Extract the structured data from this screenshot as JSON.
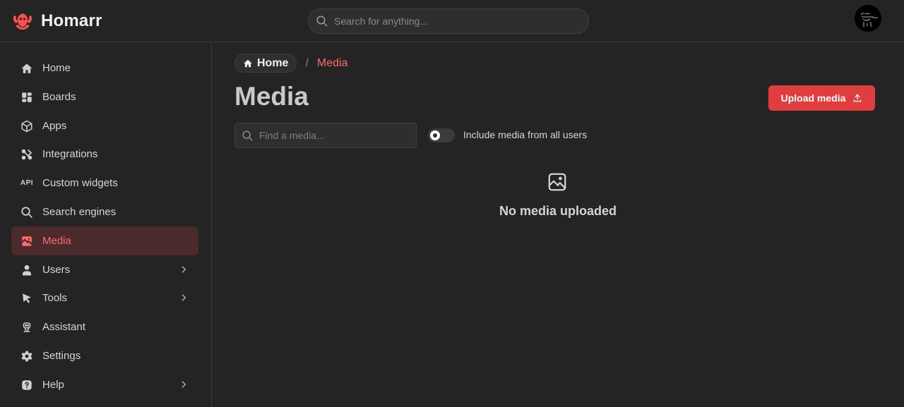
{
  "app": {
    "title": "Homarr",
    "brand_color": "#fa5252"
  },
  "header": {
    "search_placeholder": "Search for anything...",
    "avatar_icon": "user-avatar"
  },
  "sidebar": {
    "items": [
      {
        "label": "Home",
        "icon": "home-icon",
        "active": false,
        "has_children": false
      },
      {
        "label": "Boards",
        "icon": "layout-icon",
        "active": false,
        "has_children": false
      },
      {
        "label": "Apps",
        "icon": "box-icon",
        "active": false,
        "has_children": false
      },
      {
        "label": "Integrations",
        "icon": "plug-icon",
        "active": false,
        "has_children": false
      },
      {
        "label": "Custom widgets",
        "icon": "api-icon",
        "icon_text": "API",
        "active": false,
        "has_children": false
      },
      {
        "label": "Search engines",
        "icon": "search-icon",
        "active": false,
        "has_children": false
      },
      {
        "label": "Media",
        "icon": "photo-icon",
        "active": true,
        "has_children": false
      },
      {
        "label": "Users",
        "icon": "user-icon",
        "active": false,
        "has_children": true
      },
      {
        "label": "Tools",
        "icon": "pointer-icon",
        "active": false,
        "has_children": true
      },
      {
        "label": "Assistant",
        "icon": "robot-icon",
        "active": false,
        "has_children": false
      },
      {
        "label": "Settings",
        "icon": "gear-icon",
        "active": false,
        "has_children": false
      },
      {
        "label": "Help",
        "icon": "question-icon",
        "active": false,
        "has_children": true
      }
    ]
  },
  "breadcrumb": {
    "home": "Home",
    "separator": "/",
    "current": "Media"
  },
  "main": {
    "title": "Media",
    "upload_button": "Upload media",
    "find_placeholder": "Find a media...",
    "toggle_label": "Include media from all users",
    "toggle_on": false,
    "empty_text": "No media uploaded"
  }
}
